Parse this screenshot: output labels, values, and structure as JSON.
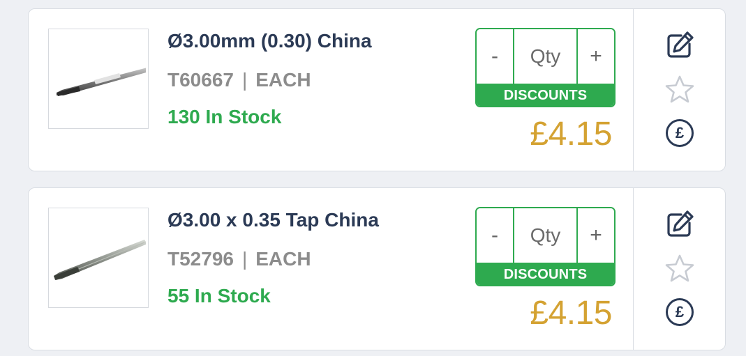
{
  "products": [
    {
      "title": "Ø3.00mm (0.30) China",
      "code": "T60667",
      "separator": "|",
      "unit": "EACH",
      "stock": "130 In Stock",
      "qty_placeholder": "Qty",
      "minus_label": "-",
      "plus_label": "+",
      "discounts_label": "DISCOUNTS",
      "price": "£4.15",
      "pound_symbol": "£"
    },
    {
      "title": "Ø3.00 x 0.35 Tap China",
      "code": "T52796",
      "separator": "|",
      "unit": "EACH",
      "stock": "55 In Stock",
      "qty_placeholder": "Qty",
      "minus_label": "-",
      "plus_label": "+",
      "discounts_label": "DISCOUNTS",
      "price": "£4.15",
      "pound_symbol": "£"
    }
  ],
  "icons": {
    "edit": "edit-icon",
    "favourite": "star-icon",
    "price_info": "pound-icon",
    "product_image": "tap-drill-image"
  },
  "colors": {
    "title": "#2b3a55",
    "stock": "#2eaa4f",
    "accent_green": "#2eaa4f",
    "price": "#d4a232",
    "meta": "#8c8c8c"
  }
}
